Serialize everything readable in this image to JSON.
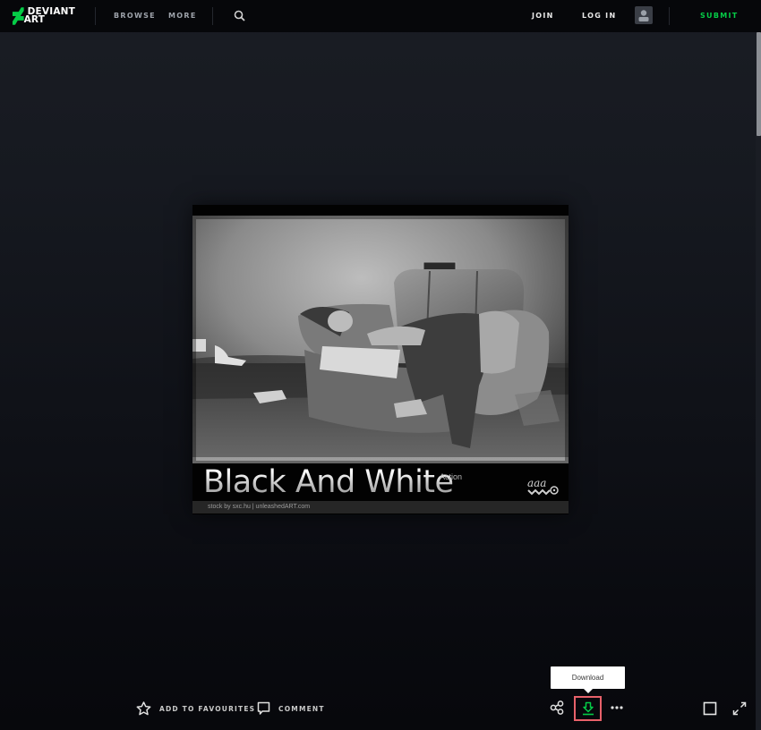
{
  "header": {
    "logo_line1": "DEVIANT",
    "logo_line2": "ART",
    "nav": [
      {
        "label": "BROWSE"
      },
      {
        "label": "MORE"
      }
    ],
    "join_label": "JOIN",
    "login_label": "LOG IN",
    "submit_label": "SUBMIT"
  },
  "artwork": {
    "title": "Black And White",
    "subtitle": "Action",
    "credits": "stock by sxc.hu | unleashedART.com",
    "badge": "aaa"
  },
  "actions": {
    "favourite_label": "ADD TO FAVOURITES",
    "comment_label": "COMMENT",
    "download_tooltip": "Download"
  },
  "colors": {
    "brand_green": "#05cc47",
    "highlight_red": "#e8616a",
    "nav_bg": "#06070a"
  }
}
